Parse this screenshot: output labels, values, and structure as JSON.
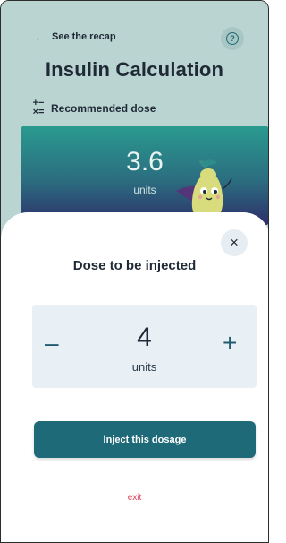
{
  "header": {
    "back_label": "See the recap",
    "help_icon": "help-circle-icon",
    "title": "Insulin Calculation"
  },
  "recommended": {
    "label": "Recommended dose",
    "value": "3.6",
    "unit": "units"
  },
  "dialog": {
    "title": "Dose to be injected",
    "stepper": {
      "minus_symbol": "–",
      "value": "4",
      "unit": "units",
      "plus_symbol": "+"
    },
    "inject_label": "Inject this dosage",
    "exit_label": "exit",
    "close_symbol": "×"
  },
  "colors": {
    "background": "#b9d4d1",
    "primary": "#1f6a78",
    "exit": "#e0405a",
    "stepper_bg": "#e8f0f6"
  }
}
